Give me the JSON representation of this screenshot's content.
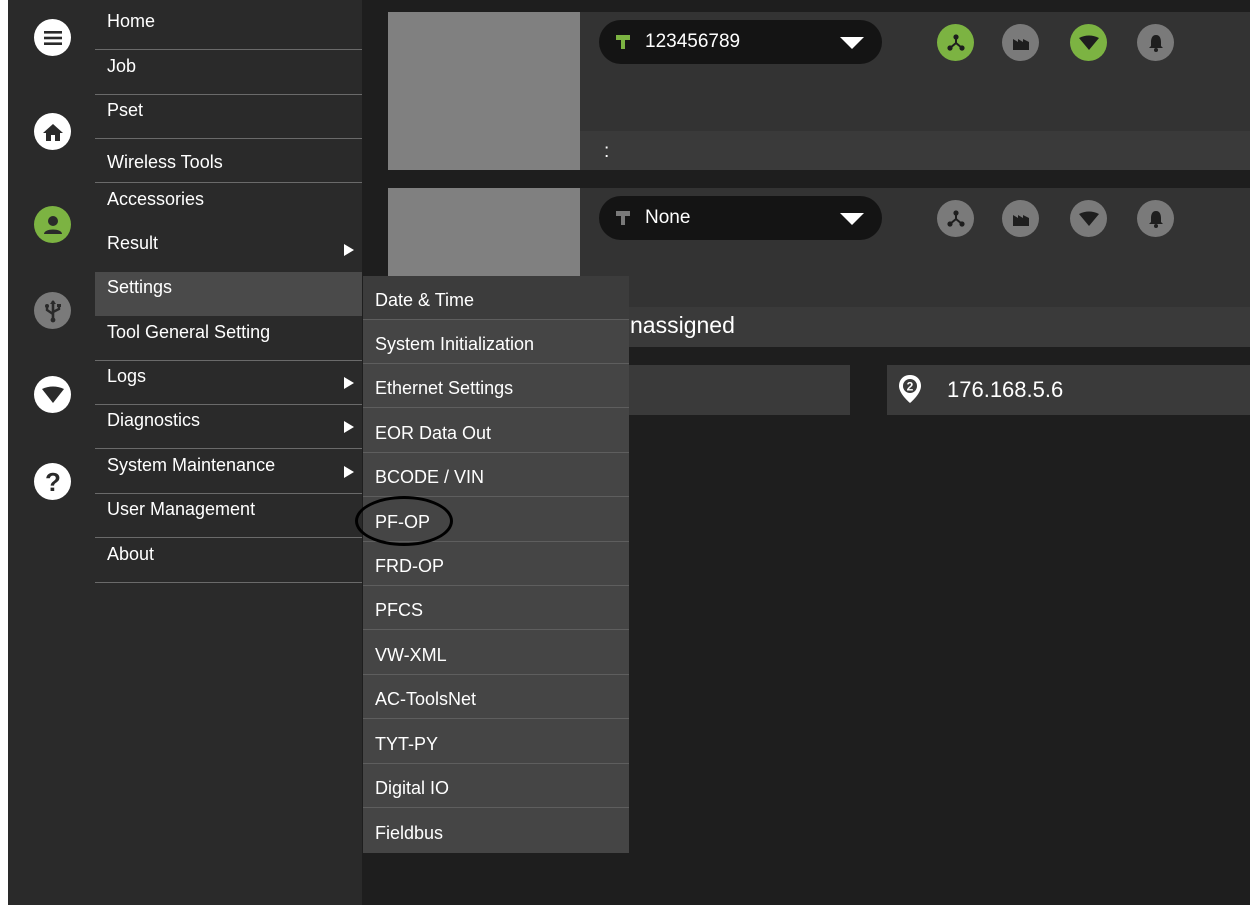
{
  "colors": {
    "accent_green": "#7cb342",
    "inactive_gray": "#7a7a7a",
    "panel_dark": "#2a2a2a"
  },
  "rail": {
    "items": [
      {
        "name": "menu-icon",
        "active": false
      },
      {
        "name": "home-icon",
        "active": false
      },
      {
        "name": "user-icon",
        "active": true
      },
      {
        "name": "usb-icon",
        "active": false
      },
      {
        "name": "wifi-icon",
        "active": false
      },
      {
        "name": "help-icon",
        "active": false
      }
    ]
  },
  "menu": {
    "items": [
      {
        "label": "Home",
        "has_submenu": false
      },
      {
        "label": "Job",
        "has_submenu": false
      },
      {
        "label": "Pset",
        "has_submenu": false
      },
      {
        "label": "Wireless Tools",
        "has_submenu": false
      },
      {
        "label": "Accessories",
        "has_submenu": false
      },
      {
        "label": "Result",
        "has_submenu": true
      },
      {
        "label": "Settings",
        "has_submenu": false,
        "active": true
      },
      {
        "label": "Tool General Setting",
        "has_submenu": false
      },
      {
        "label": "Logs",
        "has_submenu": true
      },
      {
        "label": "Diagnostics",
        "has_submenu": true
      },
      {
        "label": "System Maintenance",
        "has_submenu": true
      },
      {
        "label": "User Management",
        "has_submenu": false
      },
      {
        "label": "About",
        "has_submenu": false
      }
    ]
  },
  "submenu": {
    "items": [
      {
        "label": "Date & Time"
      },
      {
        "label": "System Initialization"
      },
      {
        "label": "Ethernet Settings"
      },
      {
        "label": "EOR Data Out"
      },
      {
        "label": "BCODE / VIN"
      },
      {
        "label": "PF-OP",
        "circled": true
      },
      {
        "label": "FRD-OP"
      },
      {
        "label": "PFCS"
      },
      {
        "label": "VW-XML"
      },
      {
        "label": "AC-ToolsNet"
      },
      {
        "label": "TYT-PY"
      },
      {
        "label": "Digital IO"
      },
      {
        "label": "Fieldbus"
      }
    ]
  },
  "tool1": {
    "selected": "123456789",
    "info": ":",
    "status": [
      {
        "name": "network-icon",
        "active": true
      },
      {
        "name": "factory-icon",
        "active": false
      },
      {
        "name": "wifi-status-icon",
        "active": true
      },
      {
        "name": "bell-icon",
        "active": false
      }
    ]
  },
  "tool2": {
    "selected": "None",
    "info": "nassigned",
    "status": [
      {
        "name": "network-icon",
        "active": false
      },
      {
        "name": "factory-icon",
        "active": false
      },
      {
        "name": "wifi-status-icon",
        "active": false
      },
      {
        "name": "bell-icon",
        "active": false
      }
    ]
  },
  "network": {
    "badge": "2",
    "ip": "176.168.5.6"
  }
}
